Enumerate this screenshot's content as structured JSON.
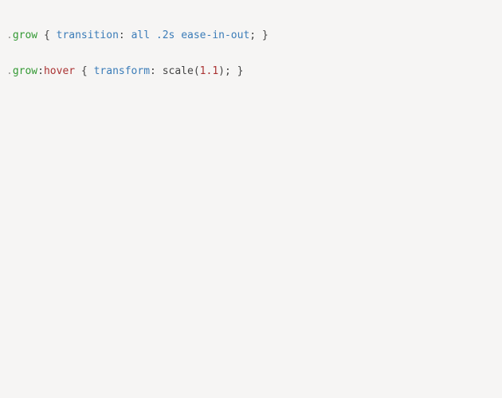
{
  "code": {
    "lines": [
      [
        {
          "t": ".",
          "c": "punct"
        },
        {
          "t": "grow",
          "c": "class"
        },
        {
          "t": " { ",
          "c": "plain"
        },
        {
          "t": "transition",
          "c": "prop"
        },
        {
          "t": ":",
          "c": "plain"
        },
        {
          "t": " ",
          "c": "plain"
        },
        {
          "t": "all",
          "c": "value"
        },
        {
          "t": " ",
          "c": "plain"
        },
        {
          "t": ".2s",
          "c": "value"
        },
        {
          "t": " ",
          "c": "plain"
        },
        {
          "t": "ease-in-out",
          "c": "value"
        },
        {
          "t": ";",
          "c": "plain"
        },
        {
          "t": " }",
          "c": "plain"
        }
      ],
      [
        {
          "t": ".",
          "c": "punct"
        },
        {
          "t": "grow",
          "c": "class"
        },
        {
          "t": ":",
          "c": "plain"
        },
        {
          "t": "hover",
          "c": "pseudo"
        },
        {
          "t": " { ",
          "c": "plain"
        },
        {
          "t": "transform",
          "c": "prop"
        },
        {
          "t": ":",
          "c": "plain"
        },
        {
          "t": " scale(",
          "c": "plain"
        },
        {
          "t": "1.1",
          "c": "number"
        },
        {
          "t": ");",
          "c": "plain"
        },
        {
          "t": " }",
          "c": "plain"
        }
      ]
    ]
  }
}
